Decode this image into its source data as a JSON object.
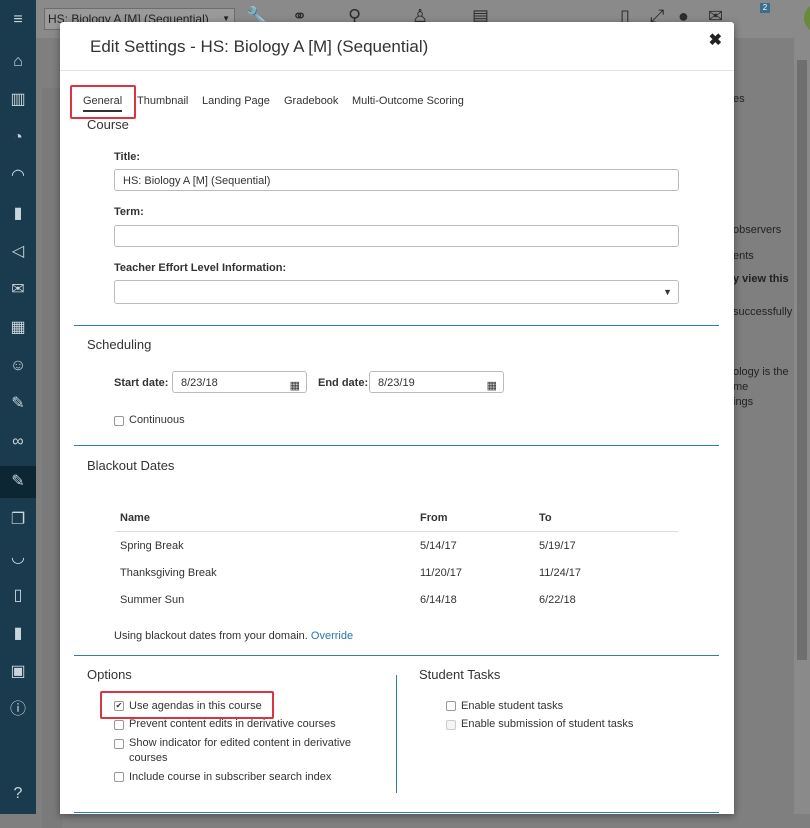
{
  "topbar": {
    "course_select": "HS: Biology A [M] (Sequential)",
    "notification_count": "2"
  },
  "background": {
    "right_texts": [
      "es",
      "observers",
      "ents",
      "y view this",
      "successfully",
      "ology is the",
      "me",
      "ings"
    ]
  },
  "modal": {
    "title": "Edit Settings - HS: Biology A [M] (Sequential)",
    "tabs": [
      "General",
      "Thumbnail",
      "Landing Page",
      "Gradebook",
      "Multi-Outcome Scoring"
    ],
    "course": {
      "section": "Course",
      "title_label": "Title:",
      "title_value": "HS: Biology A [M] (Sequential)",
      "term_label": "Term:",
      "term_value": "",
      "effort_label": "Teacher Effort Level Information:",
      "effort_value": ""
    },
    "scheduling": {
      "section": "Scheduling",
      "start_label": "Start date:",
      "start_value": "8/23/18",
      "end_label": "End date:",
      "end_value": "8/23/19",
      "continuous": "Continuous"
    },
    "blackout": {
      "section": "Blackout Dates",
      "headers": [
        "Name",
        "From",
        "To"
      ],
      "rows": [
        [
          "Spring Break",
          "5/14/17",
          "5/19/17"
        ],
        [
          "Thanksgiving Break",
          "11/20/17",
          "11/24/17"
        ],
        [
          "Summer Sun",
          "6/14/18",
          "6/22/18"
        ]
      ],
      "note": "Using blackout dates from your domain.",
      "override": "Override"
    },
    "options": {
      "section": "Options",
      "items": [
        {
          "label": "Use agendas in this course",
          "checked": true
        },
        {
          "label": "Prevent content edits in derivative courses",
          "checked": false
        },
        {
          "label": "Show indicator for edited content in derivative courses",
          "checked": false
        },
        {
          "label": "Include course in subscriber search index",
          "checked": false
        }
      ]
    },
    "student_tasks": {
      "section": "Student Tasks",
      "items": [
        {
          "label": "Enable student tasks",
          "checked": false
        },
        {
          "label": "Enable submission of student tasks",
          "checked": false
        }
      ]
    }
  },
  "colors": {
    "highlight": "#d9343f",
    "divider": "#2e7fa8",
    "nav": "#1a3b4d",
    "link": "#2a73a8"
  }
}
